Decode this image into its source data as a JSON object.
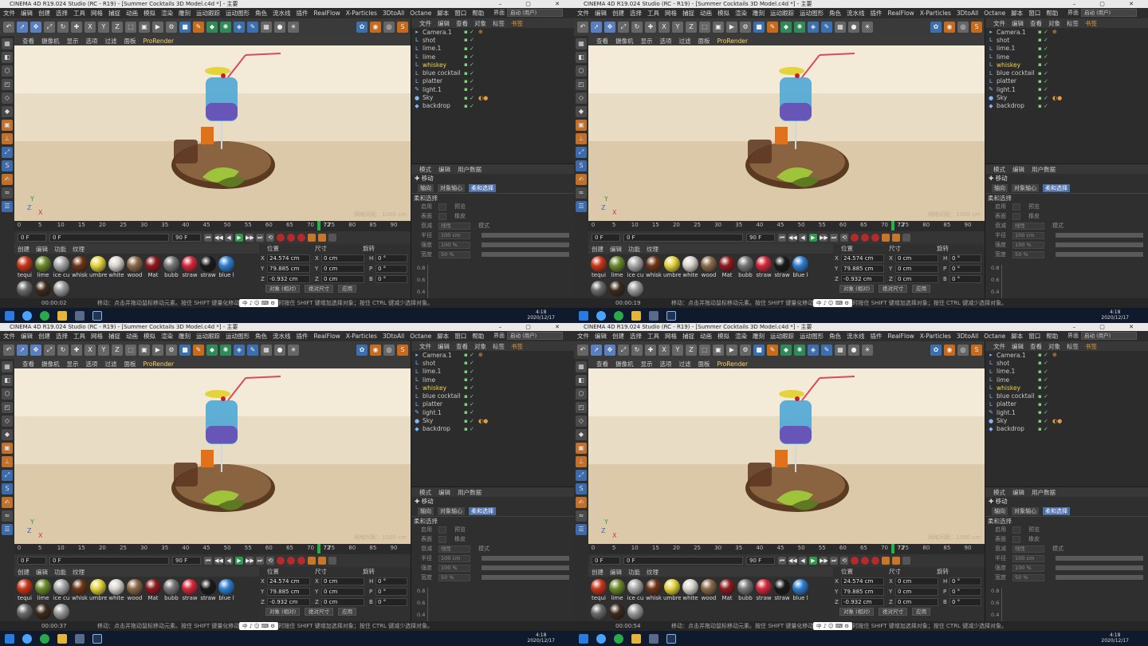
{
  "window": {
    "title": "CINEMA 4D R19.024 Studio (RC - R19) - [Summer Cocktails 3D Model.c4d *] - 主要",
    "controls": "–  ▢  ✕"
  },
  "menubar": {
    "items": [
      "文件",
      "编辑",
      "创建",
      "选择",
      "工具",
      "网格",
      "捕捉",
      "动画",
      "模拟",
      "渲染",
      "雕刻",
      "运动跟踪",
      "运动图形",
      "角色",
      "流水线",
      "插件",
      "RealFlow",
      "X-Particles",
      "3DtoAll",
      "Octane",
      "脚本",
      "窗口",
      "帮助"
    ],
    "layout_label": "界面",
    "layout_value": "启动 (用户)"
  },
  "toolbar": {
    "icons": [
      {
        "name": "undo-icon",
        "glyph": "↶",
        "style": "gray"
      },
      {
        "name": "live-select-icon",
        "glyph": "➚",
        "style": "sel"
      },
      {
        "name": "move-icon",
        "glyph": "✥",
        "style": "sel"
      },
      {
        "name": "scale-icon",
        "glyph": "⤢",
        "style": "gray"
      },
      {
        "name": "rotate-icon",
        "glyph": "↻",
        "style": "gray"
      },
      {
        "name": "add-icon",
        "glyph": "✚",
        "style": "gray"
      },
      {
        "name": "x-axis-icon",
        "glyph": "X",
        "style": "gray"
      },
      {
        "name": "y-axis-icon",
        "glyph": "Y",
        "style": "gray"
      },
      {
        "name": "z-axis-icon",
        "glyph": "Z",
        "style": "gray"
      },
      {
        "name": "coord-system-icon",
        "glyph": "⬚",
        "style": "gray"
      },
      {
        "name": "render-region-icon",
        "glyph": "▣",
        "style": "gray"
      },
      {
        "name": "render-view-icon",
        "glyph": "▶",
        "style": "gray"
      },
      {
        "name": "render-settings-icon",
        "glyph": "⚙",
        "style": "gray"
      },
      {
        "name": "cube-icon",
        "glyph": "■",
        "style": "blue"
      },
      {
        "name": "pen-icon",
        "glyph": "✎",
        "style": "orange"
      },
      {
        "name": "subdivision-icon",
        "glyph": "◆",
        "style": "green"
      },
      {
        "name": "array-icon",
        "glyph": "✺",
        "style": "green"
      },
      {
        "name": "deformer-icon",
        "glyph": "◈",
        "style": "blue"
      },
      {
        "name": "environment-icon",
        "glyph": "✎",
        "style": "blue"
      },
      {
        "name": "floor-icon",
        "glyph": "▦",
        "style": "gray"
      },
      {
        "name": "camera-icon",
        "glyph": "●",
        "style": "gray"
      },
      {
        "name": "light-icon",
        "glyph": "☀",
        "style": "gray"
      }
    ],
    "right_icons": [
      {
        "name": "xparticles-icon",
        "glyph": "✿",
        "style": "blue"
      },
      {
        "name": "realflow-icon",
        "glyph": "◉",
        "style": "orange"
      },
      {
        "name": "plugin-icon",
        "glyph": "◎",
        "style": "gray"
      },
      {
        "name": "octane-icon",
        "glyph": "S",
        "style": "orange"
      }
    ]
  },
  "viewport_menu": [
    "查看",
    "摄像机",
    "显示",
    "选项",
    "过滤",
    "面板",
    "ProRender"
  ],
  "viewport": {
    "grid_label": "网格间距：1000 cm",
    "axis_labels": [
      "Y",
      "Z",
      "X"
    ]
  },
  "timeline": {
    "ticks": [
      "0",
      "5",
      "10",
      "15",
      "20",
      "25",
      "30",
      "35",
      "40",
      "45",
      "50",
      "55",
      "60",
      "65",
      "70",
      "75",
      "80",
      "85",
      "90"
    ]
  },
  "timeline_ends": {
    "end_right": "72 F"
  },
  "transport": {
    "start_field": "0 F",
    "end_field": "90 F",
    "max_field": "90 F",
    "buttons": [
      "⏮",
      "◀◀",
      "◀",
      "▶",
      "▶▶",
      "⏭",
      "⟲"
    ]
  },
  "materials": {
    "tabs": [
      "创建",
      "编辑",
      "功能",
      "纹理"
    ],
    "items": [
      {
        "label": "tequi",
        "color": "#c8371a"
      },
      {
        "label": "lime",
        "color": "#6c8a2c"
      },
      {
        "label": "ice cu",
        "color": "#a8a8a8"
      },
      {
        "label": "whisk",
        "color": "#6d3516"
      },
      {
        "label": "umbrel",
        "color": "#e3d43a"
      },
      {
        "label": "white",
        "color": "#d9d4cc"
      },
      {
        "label": "wood",
        "color": "#8a6a4a"
      },
      {
        "label": "Mat",
        "color": "#8d1a1e"
      },
      {
        "label": "bubb",
        "color": "#777777"
      },
      {
        "label": "straw",
        "color": "#d4283a"
      },
      {
        "label": "straw",
        "color": "#1a1a1a"
      },
      {
        "label": "blue l",
        "color": "#2e7fd1"
      }
    ],
    "row2": [
      {
        "label": "",
        "color": "#6a6a6a"
      },
      {
        "label": "",
        "color": "#3c2a1c"
      },
      {
        "label": "",
        "color": "#9a9a9a"
      }
    ]
  },
  "coordinates": {
    "headers": [
      "位置",
      "尺寸",
      "旋转"
    ],
    "rows": [
      {
        "axis": "X",
        "pos": "24.574 cm",
        "size": "0 cm",
        "rot_axis": "H",
        "rot": "0 °"
      },
      {
        "axis": "Y",
        "pos": "79.885 cm",
        "size": "0 cm",
        "rot_axis": "P",
        "rot": "0 °"
      },
      {
        "axis": "Z",
        "pos": "-0.932 cm",
        "size": "0 cm",
        "rot_axis": "B",
        "rot": "0 °"
      }
    ],
    "mode_button": "对象 (相对)",
    "size_button": "绝对尺寸",
    "apply_button": "应用"
  },
  "object_manager": {
    "tabs": [
      "文件",
      "编辑",
      "查看",
      "对象",
      "标签",
      "书签"
    ],
    "objects": [
      {
        "name": "Camera.1",
        "icon": "camera-icon",
        "glyph": "▸",
        "highlight": false,
        "tag": "⊕"
      },
      {
        "name": "shot",
        "icon": "null-icon",
        "glyph": "L",
        "highlight": false,
        "tag": ""
      },
      {
        "name": "lime.1",
        "icon": "null-icon",
        "glyph": "L",
        "highlight": false,
        "tag": ""
      },
      {
        "name": "lime",
        "icon": "null-icon",
        "glyph": "L",
        "highlight": false,
        "tag": ""
      },
      {
        "name": "whiskey",
        "icon": "null-icon",
        "glyph": "L",
        "highlight": true,
        "tag": ""
      },
      {
        "name": "blue cocktail",
        "icon": "null-icon",
        "glyph": "L",
        "highlight": false,
        "tag": ""
      },
      {
        "name": "platter",
        "icon": "null-icon",
        "glyph": "L",
        "highlight": false,
        "tag": ""
      },
      {
        "name": "light.1",
        "icon": "light-icon",
        "glyph": "✎",
        "highlight": false,
        "tag": ""
      },
      {
        "name": "Sky",
        "icon": "sky-icon",
        "glyph": "●",
        "highlight": false,
        "tag": "◐●"
      },
      {
        "name": "backdrop",
        "icon": "backdrop-icon",
        "glyph": "◆",
        "highlight": false,
        "tag": ""
      }
    ]
  },
  "attribute_manager": {
    "tabs": [
      "模式",
      "编辑",
      "用户数据"
    ],
    "title": "移动",
    "subtabs": [
      "轴向",
      "对象轴心",
      "柔和选择"
    ],
    "section": "柔和选择",
    "rows": [
      {
        "k": "启用",
        "v": "",
        "b": "预览"
      },
      {
        "k": "表面",
        "v": "",
        "b": "橡皮"
      },
      {
        "k": "衰减",
        "v": "线性",
        "b": "模式"
      },
      {
        "k": "半径",
        "v": "100 cm",
        "b": ""
      },
      {
        "k": "强度",
        "v": "100 %",
        "b": ""
      },
      {
        "k": "宽度",
        "v": "50 %",
        "b": ""
      }
    ],
    "graph_labels": [
      "0.8",
      "0.6",
      "0.4"
    ]
  },
  "statusbar": {
    "message": "移动：点击并拖动鼠标移动元素。按住 SHIFT 键量化移动；节点编辑模式时按住 SHIFT 键增加选择对象；按住 CTRL 键减少选择对象。",
    "ime": "中 ♪ ☺ ⌨ ⚙"
  },
  "taskbar": {
    "clock_time": "4:18",
    "clock_date": "2020/12/17"
  },
  "quadrants": [
    {
      "timecode": "00:00:02",
      "frame": "72",
      "marker_frame": 72
    },
    {
      "timecode": "00:00:19",
      "frame": "72",
      "marker_frame": 72
    },
    {
      "timecode": "00:00:37",
      "frame": "72",
      "marker_frame": 72
    },
    {
      "timecode": "00:00:54",
      "frame": "72",
      "marker_frame": 72
    }
  ],
  "colors": {
    "accent_selected": "#f2d24e",
    "timeline_marker": "#23b34a",
    "active_tab": "#e89b3a"
  }
}
